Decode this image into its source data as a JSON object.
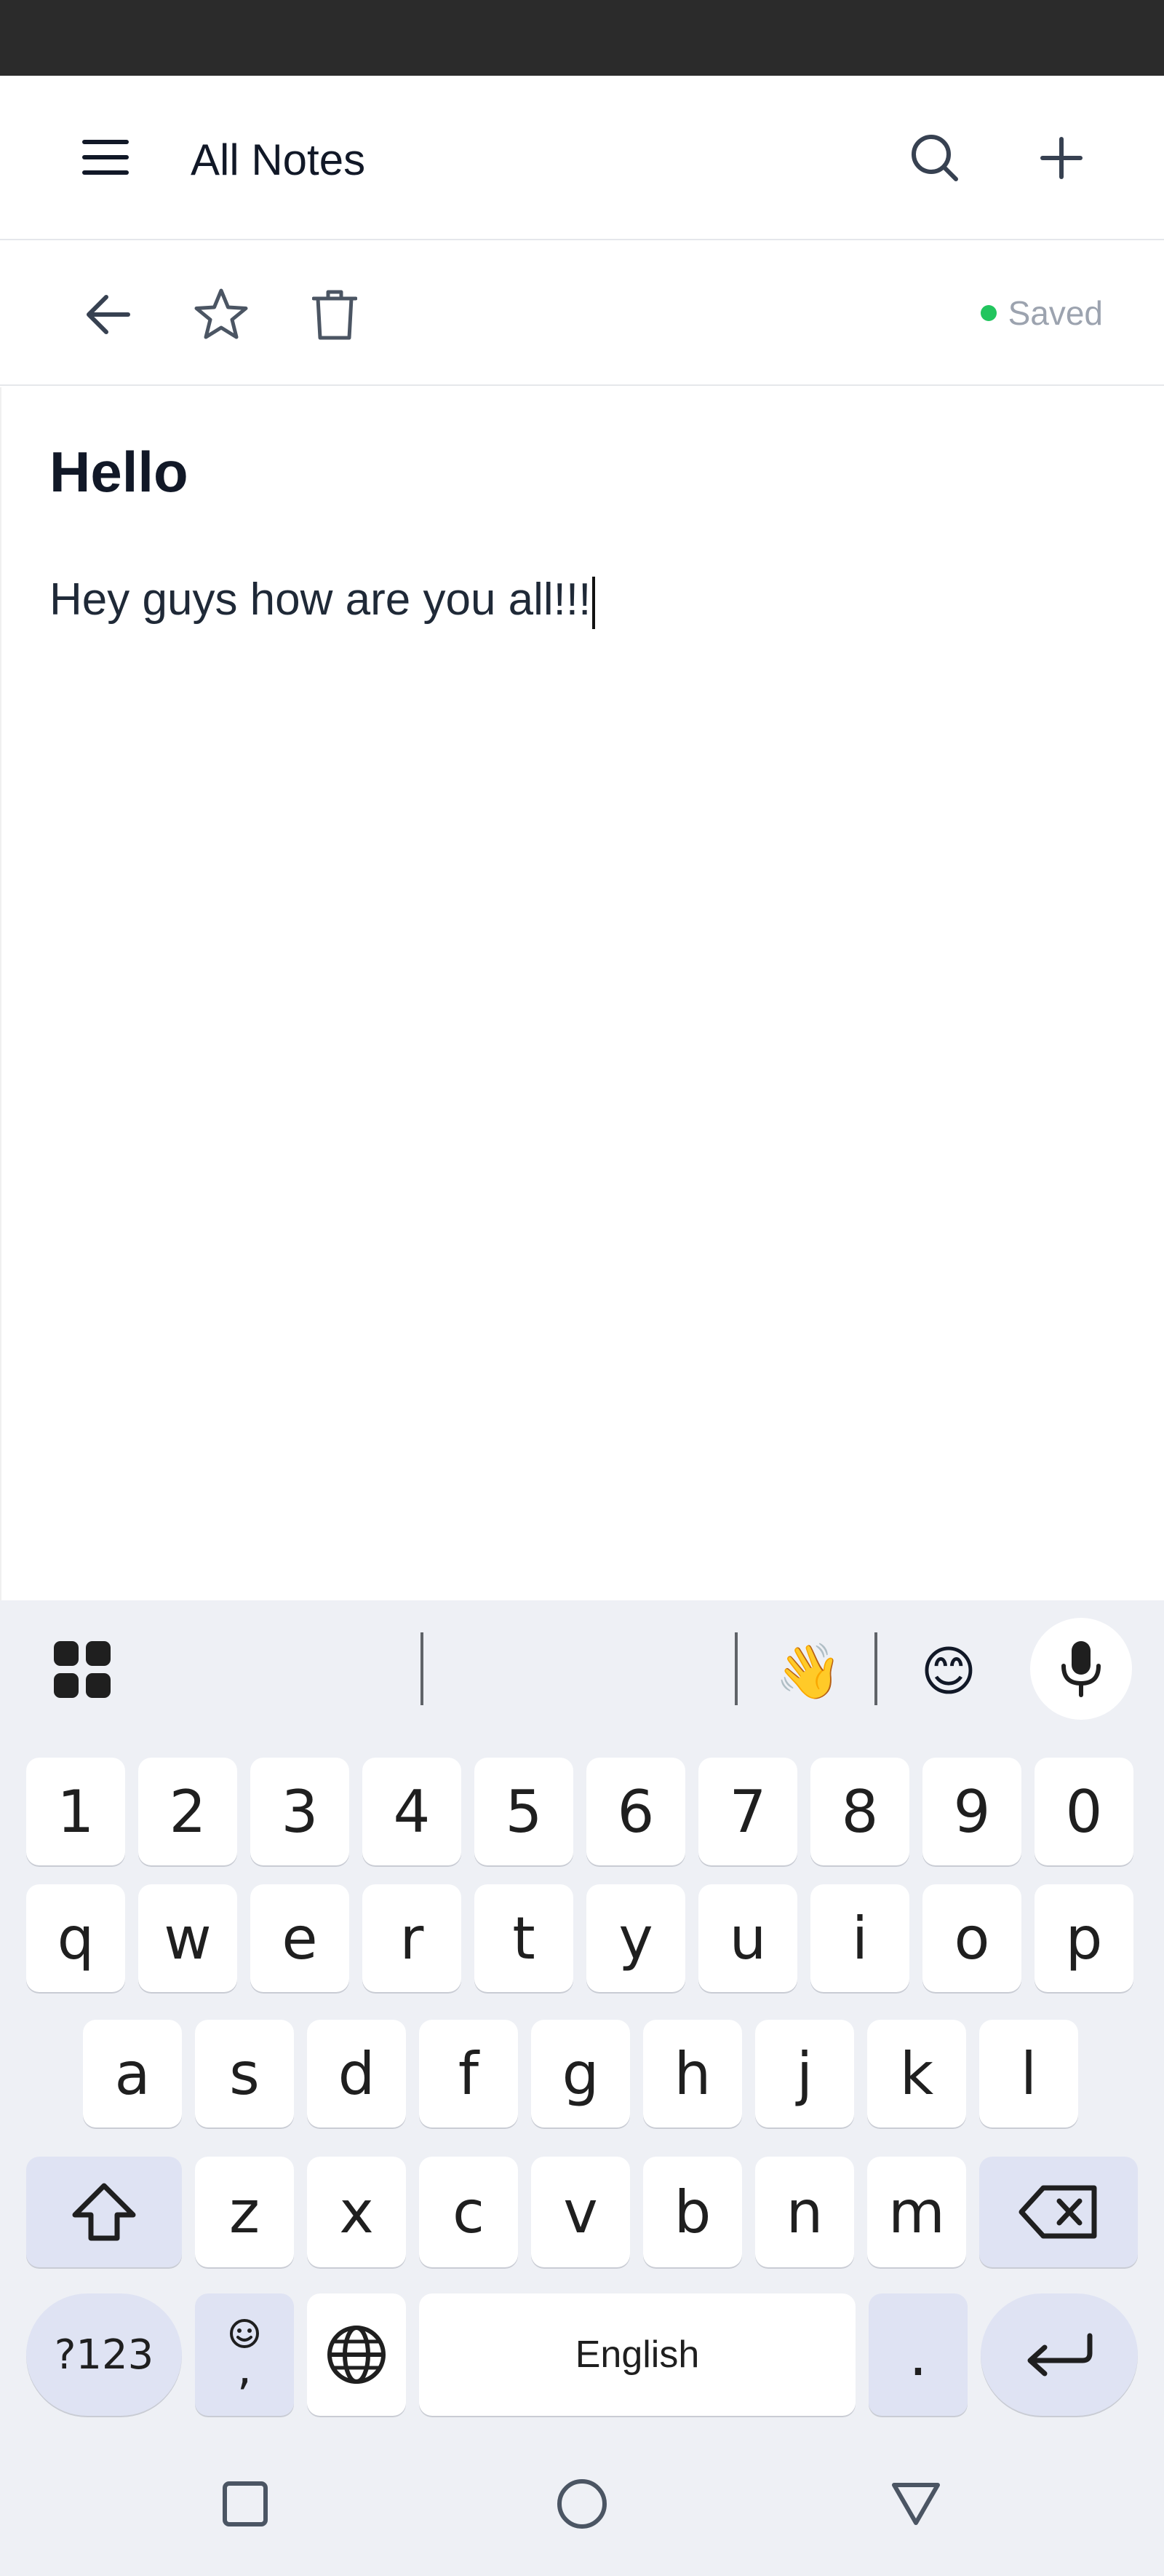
{
  "header": {
    "title": "All Notes"
  },
  "toolbar": {
    "saved_label": "Saved",
    "saved_color": "#22c55e"
  },
  "note": {
    "title": "Hello",
    "body": "Hey guys how are you all!!!"
  },
  "keyboard": {
    "suggestions": [
      "",
      "",
      "👋",
      "😊"
    ],
    "number_row": [
      "1",
      "2",
      "3",
      "4",
      "5",
      "6",
      "7",
      "8",
      "9",
      "0"
    ],
    "row1": [
      "q",
      "w",
      "e",
      "r",
      "t",
      "y",
      "u",
      "i",
      "o",
      "p"
    ],
    "row2": [
      "a",
      "s",
      "d",
      "f",
      "g",
      "h",
      "j",
      "k",
      "l"
    ],
    "row3": [
      "z",
      "x",
      "c",
      "v",
      "b",
      "n",
      "m"
    ],
    "symbols_label": "?123",
    "emoji_comma_label": ",",
    "space_label": "English",
    "period_label": "."
  }
}
